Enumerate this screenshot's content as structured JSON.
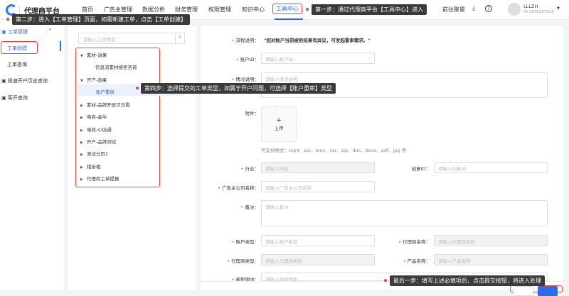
{
  "header": {
    "brand": "代理商平台",
    "nav": [
      "首页",
      "广告主管理",
      "数据分析",
      "财务管理",
      "权限管理",
      "知识中心",
      "工具中心"
    ],
    "goto": "前往聚星",
    "user_name": "LLLZH",
    "user_id": "ID:1876287523"
  },
  "tips": {
    "step1": "第一步：通过代理商平台【工具中心】进入",
    "step2": "第二步：进入【工单管理】页面，如需新建工单，点击【工单创建】",
    "step4": "第四步：选择提交的工单类型，如属于开户问题，可选择【账户重审】类型",
    "last": "最后一步：填写上述必填项后，点击提交按钮，将进入处理"
  },
  "sidebar": {
    "group": "工单管理",
    "items": [
      "工单创建",
      "工单查询"
    ],
    "others": [
      "极速开户历史查询",
      "客开查询"
    ]
  },
  "tree": {
    "search_placeholder": "请输入工单类型",
    "nodes": [
      {
        "label": "素材-效果",
        "expanded": true,
        "children": [
          "信息流素材被拒咨询"
        ]
      },
      {
        "label": "开户-效果",
        "expanded": true,
        "children": [
          "账户重审"
        ]
      },
      {
        "label": "素材-品牌开屏次日看"
      },
      {
        "label": "电商-金牛"
      },
      {
        "label": "电商-小店通"
      },
      {
        "label": "开户-品牌测试"
      },
      {
        "label": "测试分页1"
      },
      {
        "label": "相亲相"
      },
      {
        "label": "代理商工单提报"
      }
    ],
    "selected": "账户重审"
  },
  "form": {
    "flow_label": "流程说明：",
    "flow_text": "\"如对账户当前被拒结果有异议，可发起重审需求。\"",
    "account_id_label": "账户ID：",
    "account_id_ph": "请输入账户ID",
    "situation_label": "情况说明：",
    "situation_ph": "请输入情况说明",
    "attach_label": "附件：",
    "upload_plus": "+",
    "upload_label": "上传",
    "formats": "可支持格式：mp4、avi、mov、rar、zip、doc、docx、pdf、jpg 等",
    "industry_label": "行业：",
    "industry_ph": "请输入行业",
    "creative_label": "创意ID：",
    "creative_ph": "请输入创意ID",
    "company_label": "广告主公司名称：",
    "company_ph": "请输入广告主公司名称",
    "remark_label": "备注：",
    "remark_ph": "请输入备注",
    "acct_type_label": "账户类型：",
    "acct_type_ph": "请输入账户类型",
    "agent_name_label": "代理商名称：",
    "agent_name_ph": "请输入代理商名称",
    "agent_type_label": "代理商类型：",
    "agent_type_ph": "请输入代理商类型",
    "product_label": "产品名称：",
    "product_ph": "请输入产品名称",
    "reason_label": "被拒理由：",
    "reason_ph": "请输入被拒理由"
  },
  "colors": {
    "accent": "#2a6cf0",
    "highlight": "#e94335"
  }
}
